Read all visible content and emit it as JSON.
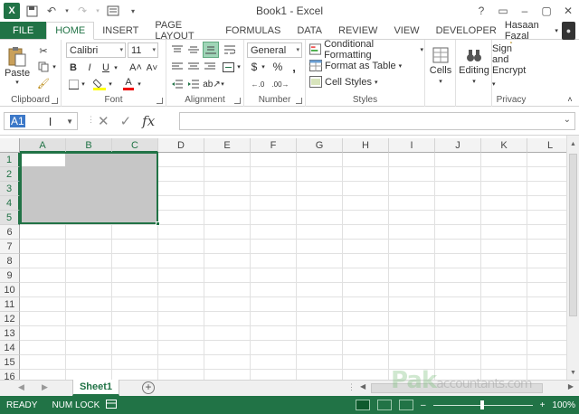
{
  "window": {
    "title": "Book1 - Excel",
    "controls": [
      "?",
      "▭",
      "–",
      "▢",
      "✕"
    ]
  },
  "qat": {
    "app_badge": "X"
  },
  "tabs": [
    {
      "label": "FILE"
    },
    {
      "label": "HOME"
    },
    {
      "label": "INSERT"
    },
    {
      "label": "PAGE LAYOUT"
    },
    {
      "label": "FORMULAS"
    },
    {
      "label": "DATA"
    },
    {
      "label": "REVIEW"
    },
    {
      "label": "VIEW"
    },
    {
      "label": "DEVELOPER"
    }
  ],
  "user": {
    "name": "Hasaan Fazal"
  },
  "ribbon": {
    "clipboard": {
      "label": "Clipboard",
      "paste": "Paste"
    },
    "font": {
      "label": "Font",
      "font_name": "Calibri",
      "font_size": "11",
      "bold": "B",
      "italic": "I",
      "underline": "U",
      "grow": "A˄",
      "shrink": "A˅"
    },
    "alignment": {
      "label": "Alignment"
    },
    "number": {
      "label": "Number",
      "format": "General",
      "currency": "$",
      "percent": "%",
      "comma": ","
    },
    "styles": {
      "label": "Styles",
      "conditional": "Conditional Formatting",
      "format_table": "Format as Table",
      "cell_styles": "Cell Styles"
    },
    "cells": {
      "label": "Cells"
    },
    "editing": {
      "label": "Editing"
    },
    "privacy": {
      "group_label": "Privacy",
      "sign_line1": "Sign and",
      "sign_line2": "Encrypt"
    }
  },
  "formula_bar": {
    "name_box": "A1",
    "cancel": "✕",
    "enter": "✓",
    "fx": "fx",
    "value": ""
  },
  "grid": {
    "columns": [
      "A",
      "B",
      "C",
      "D",
      "E",
      "F",
      "G",
      "H",
      "I",
      "J",
      "K",
      "L"
    ],
    "rows": [
      "1",
      "2",
      "3",
      "4",
      "5",
      "6",
      "7",
      "8",
      "9",
      "10",
      "11",
      "12",
      "13",
      "14",
      "15",
      "16"
    ],
    "selected_range": "A1:C5"
  },
  "sheets": [
    {
      "name": "Sheet1"
    }
  ],
  "status": {
    "ready": "READY",
    "num_lock": "NUM LOCK",
    "zoom": "100%"
  },
  "watermark": {
    "main": "Pak",
    "sub": "accountants.com"
  }
}
